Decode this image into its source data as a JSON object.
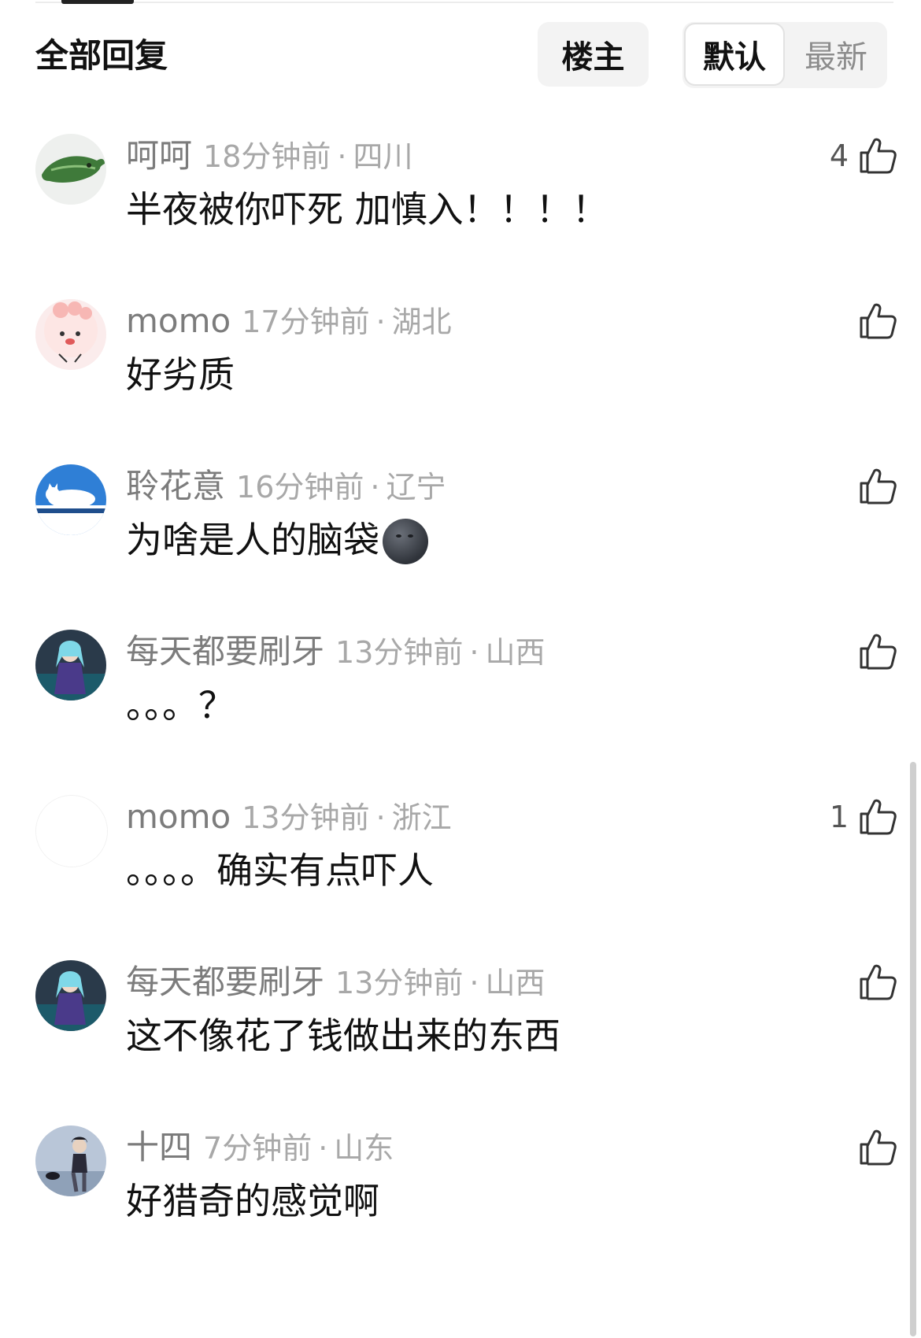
{
  "header": {
    "title": "全部回复",
    "floor_button": "楼主",
    "sort_options": {
      "default": "默认",
      "newest": "最新"
    }
  },
  "comments": [
    {
      "username": "呵呵",
      "time": "18分钟前",
      "location": "四川",
      "content": "半夜被你吓死 加慎入！！！！",
      "likes": "4",
      "avatar_icon": "green-fish-avatar"
    },
    {
      "username": "momo",
      "time": "17分钟前",
      "location": "湖北",
      "content": "好劣质",
      "likes": "",
      "avatar_icon": "pink-cartoon-avatar"
    },
    {
      "username": "聆花意",
      "time": "16分钟前",
      "location": "辽宁",
      "content": "为啥是人的脑袋",
      "likes": "",
      "avatar_icon": "sleeping-cat-avatar",
      "emoji": "new-moon-face"
    },
    {
      "username": "每天都要刷牙",
      "time": "13分钟前",
      "location": "山西",
      "content": "。。。？",
      "likes": "",
      "avatar_icon": "anime-girl-avatar"
    },
    {
      "username": "momo",
      "time": "13分钟前",
      "location": "浙江",
      "content": "。。。。确实有点吓人",
      "likes": "1",
      "avatar_icon": "blank-avatar"
    },
    {
      "username": "每天都要刷牙",
      "time": "13分钟前",
      "location": "山西",
      "content": "这不像花了钱做出来的东西",
      "likes": "",
      "avatar_icon": "anime-girl-avatar"
    },
    {
      "username": "十四",
      "time": "7分钟前",
      "location": "山东",
      "content": "好猎奇的感觉啊",
      "likes": "",
      "avatar_icon": "anime-boy-avatar"
    }
  ],
  "separator": "·",
  "colors": {
    "username": "#7c7c7c",
    "meta": "#a8a8a8",
    "text": "#111111"
  }
}
